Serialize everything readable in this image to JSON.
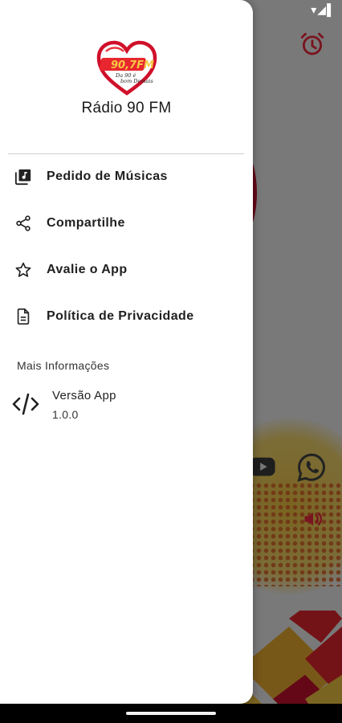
{
  "drawer": {
    "app_name": "Rádio 90 FM",
    "logo": {
      "brand_text": "90,7FM",
      "tagline": "Da 90 é bom Demais"
    },
    "menu": [
      {
        "label": "Pedido de Músicas",
        "icon": "music-library-icon"
      },
      {
        "label": "Compartilhe",
        "icon": "share-icon"
      },
      {
        "label": "Avalie o App",
        "icon": "star-outline-icon"
      },
      {
        "label": "Política de Privacidade",
        "icon": "document-icon"
      }
    ],
    "section_title": "Mais Informações",
    "version": {
      "title": "Versão App",
      "value": "1.0.0",
      "icon": "code-icon"
    }
  },
  "background_app": {
    "icons": [
      "alarm-icon",
      "youtube-icon",
      "whatsapp-icon",
      "volume-icon"
    ]
  },
  "colors": {
    "accent_red": "#c8102e",
    "drawer_bg": "#ffffff",
    "text_dark": "#1f1f1f",
    "divider": "#cfcfcf"
  }
}
